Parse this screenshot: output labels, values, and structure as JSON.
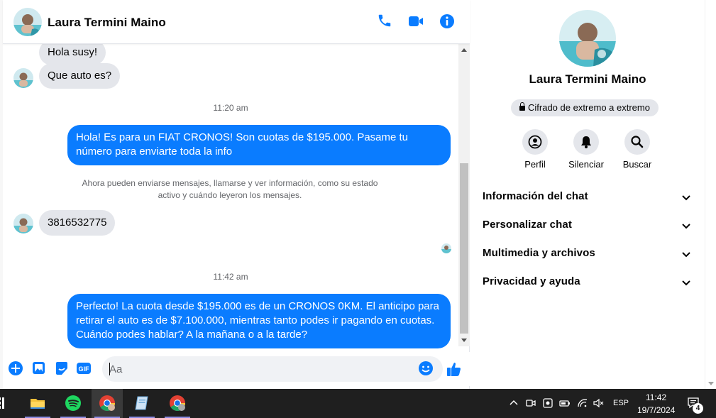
{
  "contact": {
    "name": "Laura Termini Maino"
  },
  "messages": {
    "in_1": "Hola susy!",
    "in_2": "Que auto es?",
    "time_1": "11:20 am",
    "out_1": "Hola! Es para un FIAT CRONOS! Son cuotas de $195.000. Pasame tu número para enviarte toda la info",
    "system_note": "Ahora pueden enviarse mensajes, llamarse y ver información, como su estado activo y cuándo leyeron los mensajes.",
    "in_3": "3816532775",
    "time_2": "11:42 am",
    "out_2": "Perfecto! La cuota desde $195.000 es de un CRONOS 0KM. El anticipo para retirar el auto es de $7.100.000, mientras tanto podes ir pagando en cuotas. Cuándo podes hablar? A la mañana o a la tarde?"
  },
  "composer": {
    "placeholder": "Aa"
  },
  "info_panel": {
    "name": "Laura Termini Maino",
    "encryption": "Cifrado de extremo a extremo",
    "actions": [
      {
        "label": "Perfil",
        "icon": "profile-icon"
      },
      {
        "label": "Silenciar",
        "icon": "bell-icon"
      },
      {
        "label": "Buscar",
        "icon": "search-icon"
      }
    ],
    "sections": [
      {
        "label": "Información del chat"
      },
      {
        "label": "Personalizar chat"
      },
      {
        "label": "Multimedia y archivos"
      },
      {
        "label": "Privacidad y ayuda"
      }
    ]
  },
  "taskbar": {
    "language": "ESP",
    "time": "11:42",
    "date": "19/7/2024",
    "notifications": "4"
  },
  "colors": {
    "accent": "#0a7cff",
    "incoming_bubble": "#e4e6eb",
    "taskbar": "#1f1f1f"
  }
}
